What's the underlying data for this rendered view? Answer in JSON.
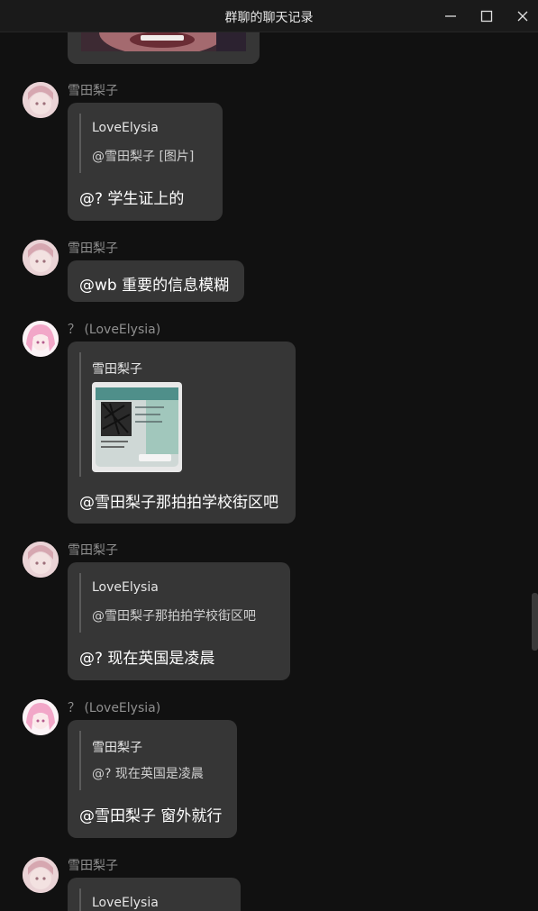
{
  "window": {
    "title": "群聊的聊天记录"
  },
  "messages": [
    {
      "sender": "雪田梨子",
      "quote_name": "LoveElysia",
      "quote_text": "@雪田梨子 [图片]",
      "text": "@? 学生证上的"
    },
    {
      "sender": "雪田梨子",
      "text": "@wb 重要的信息模糊"
    },
    {
      "sender": "？ (LoveElysia)",
      "quote_name": "雪田梨子",
      "quote_image": "id-card-photo",
      "text": "@雪田梨子那拍拍学校街区吧"
    },
    {
      "sender": "雪田梨子",
      "quote_name": "LoveElysia",
      "quote_text": "@雪田梨子那拍拍学校街区吧",
      "text": "@? 现在英国是凌晨"
    },
    {
      "sender": "？ (LoveElysia)",
      "quote_name": "雪田梨子",
      "quote_text": "@? 现在英国是凌晨",
      "text": "@雪田梨子 窗外就行"
    },
    {
      "sender": "雪田梨子",
      "quote_name": "LoveElysia"
    }
  ],
  "icons": {
    "minimize": "minimize-icon",
    "maximize": "maximize-icon",
    "close": "close-icon"
  },
  "colors": {
    "background": "#111111",
    "bubble": "#363636",
    "sender": "#8f8f8f",
    "quote_bar": "#5a5a5a"
  }
}
